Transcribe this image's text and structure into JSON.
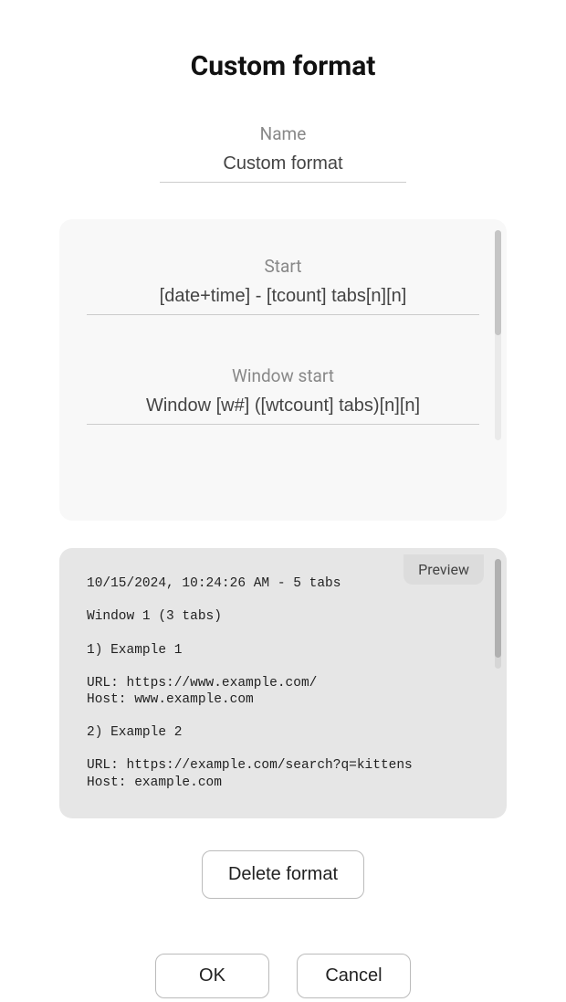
{
  "dialog": {
    "title": "Custom format",
    "name_label": "Name",
    "name_value": "Custom format",
    "format": {
      "start_label": "Start",
      "start_value": "[date+time] - [tcount] tabs[n][n]",
      "window_start_label": "Window start",
      "window_start_value": "Window [w#] ([wtcount] tabs)[n][n]"
    },
    "preview": {
      "badge": "Preview",
      "text": "10/15/2024, 10:24:26 AM - 5 tabs\n\nWindow 1 (3 tabs)\n\n1) Example 1\n\nURL: https://www.example.com/\nHost: www.example.com\n\n2) Example 2\n\nURL: https://example.com/search?q=kittens\nHost: example.com"
    },
    "delete_label": "Delete format",
    "ok_label": "OK",
    "cancel_label": "Cancel"
  }
}
